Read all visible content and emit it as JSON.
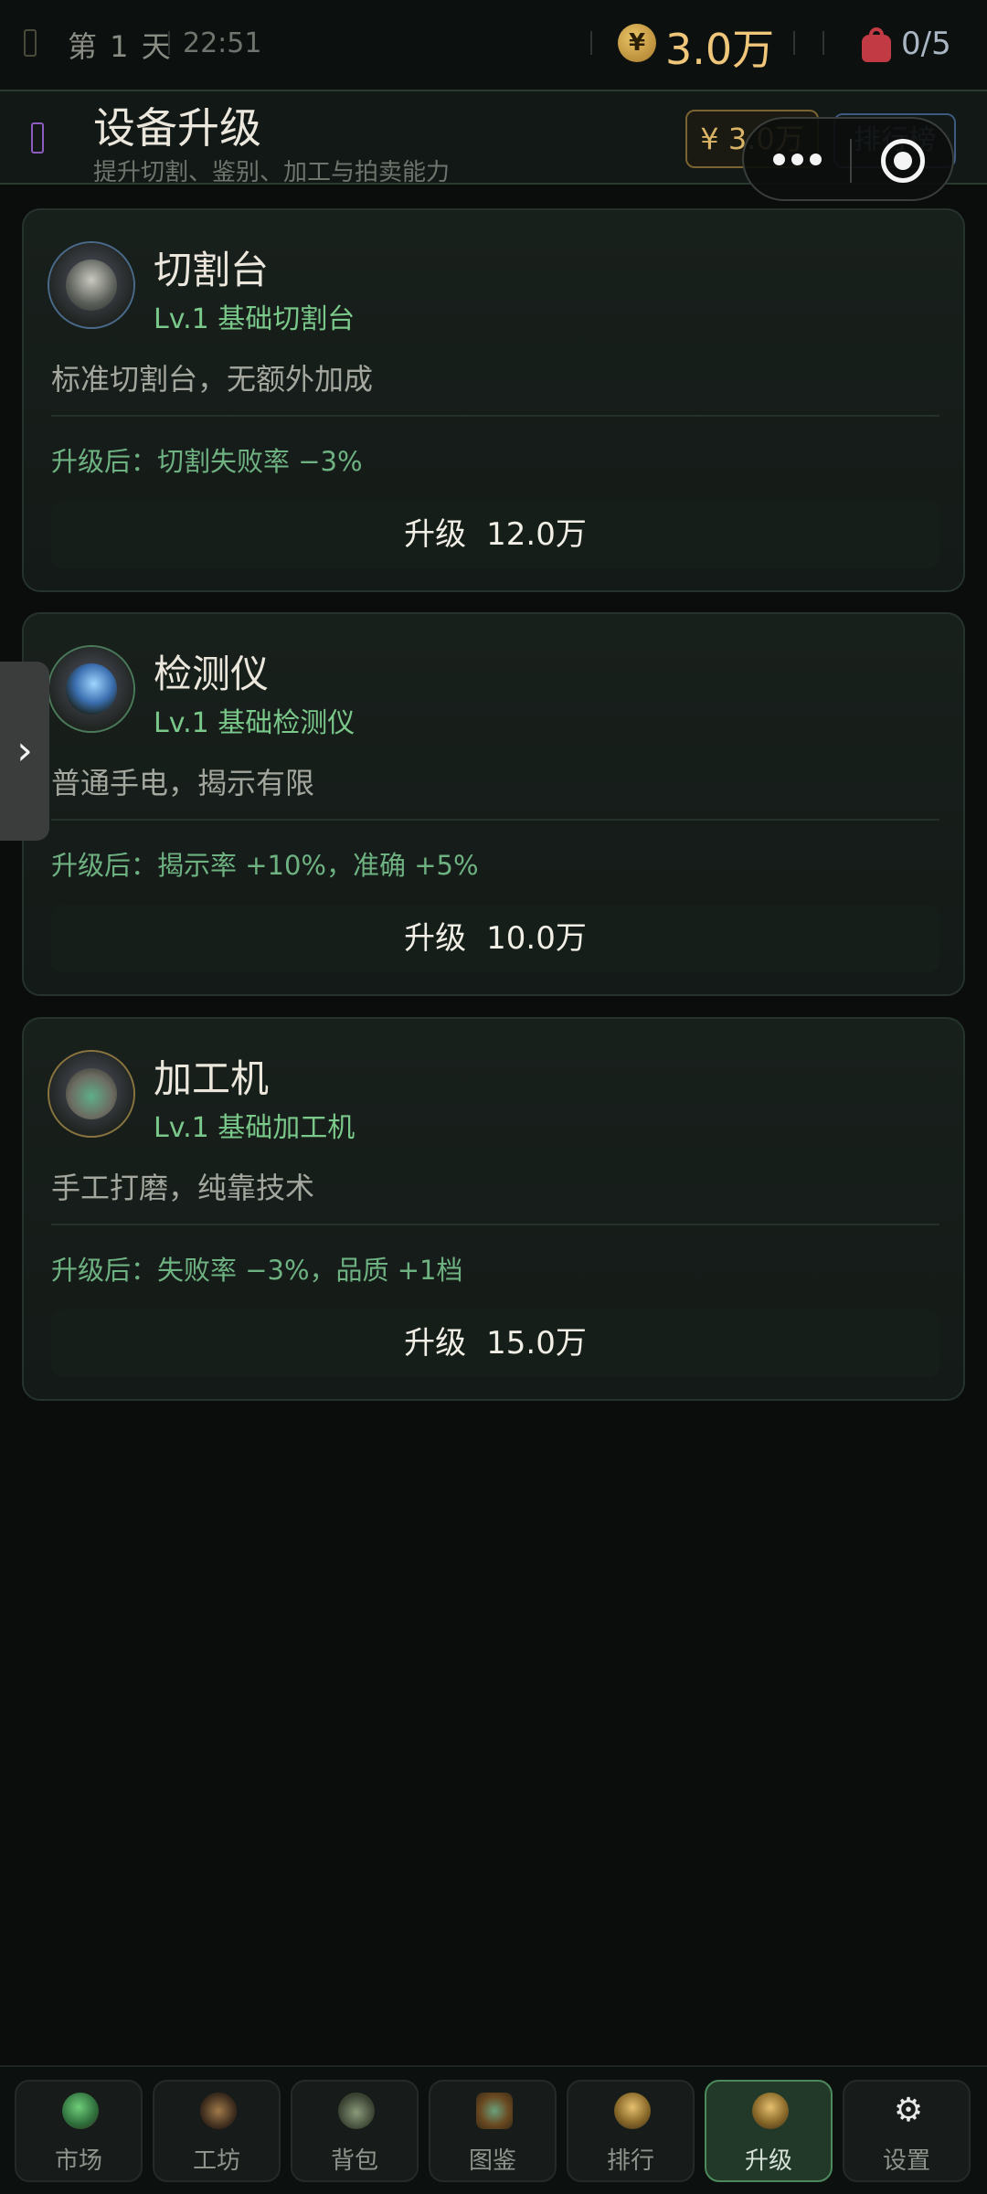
{
  "status": {
    "day": "第 1 天",
    "time": "22:51",
    "coin_symbol": "¥",
    "money": "3.0万",
    "bag_count": "0/5"
  },
  "header": {
    "title": "设备升级",
    "subtitle": "提升切割、鉴别、加工与拍卖能力",
    "money": "¥ 3.0万",
    "rank_label": "排行榜"
  },
  "side_tab": {
    "glyph": "›"
  },
  "equipment": [
    {
      "name": "切割台",
      "level": "Lv.1 基础切割台",
      "desc": "标准切割台，无额外加成",
      "effect": "升级后：切割失败率 −3%",
      "button_label": "升级",
      "cost": "12.0万",
      "icon": "cutting-table-icon"
    },
    {
      "name": "检测仪",
      "level": "Lv.1 基础检测仪",
      "desc": "普通手电，揭示有限",
      "effect": "升级后：揭示率 +10%，准确 +5%",
      "button_label": "升级",
      "cost": "10.0万",
      "icon": "detector-icon"
    },
    {
      "name": "加工机",
      "level": "Lv.1 基础加工机",
      "desc": "手工打磨，纯靠技术",
      "effect": "升级后：失败率 −3%，品质 +1档",
      "button_label": "升级",
      "cost": "15.0万",
      "icon": "processing-machine-icon"
    }
  ],
  "nav": [
    {
      "label": "市场",
      "icon": "market-icon",
      "active": false
    },
    {
      "label": "工坊",
      "icon": "workshop-icon",
      "active": false
    },
    {
      "label": "背包",
      "icon": "backpack-icon",
      "active": false
    },
    {
      "label": "图鉴",
      "icon": "catalog-icon",
      "active": false
    },
    {
      "label": "排行",
      "icon": "ranking-icon",
      "active": false
    },
    {
      "label": "升级",
      "icon": "upgrade-icon",
      "active": true
    },
    {
      "label": "设置",
      "icon": "settings-icon",
      "active": false
    }
  ],
  "colors": {
    "accent_gold": "#f0c77a",
    "level_green": "#7ac88a",
    "effect_green": "#6fb282",
    "active_tab_border": "#4c8a5c"
  }
}
